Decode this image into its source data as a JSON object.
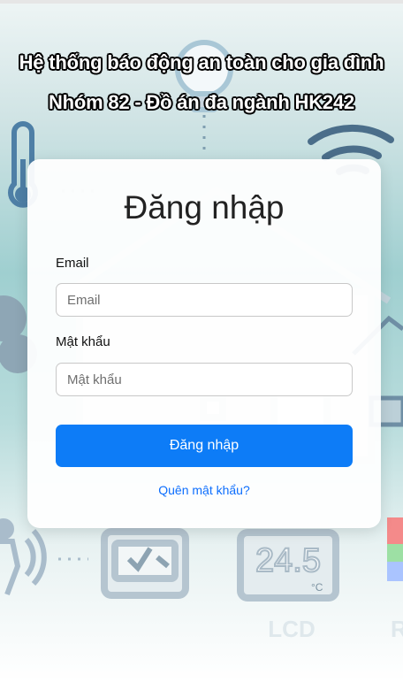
{
  "header": {
    "title": "Hệ thống báo động an toàn cho gia đình",
    "subtitle": "Nhóm 82 - Đồ án đa ngành HK242"
  },
  "login": {
    "heading": "Đăng nhập",
    "email_label": "Email",
    "email_placeholder": "Email",
    "email_value": "",
    "password_label": "Mật khẩu",
    "password_placeholder": "Mật khẩu",
    "password_value": "",
    "submit_label": "Đăng nhập",
    "forgot_link": "Quên mật khẩu?"
  },
  "background": {
    "lcd_reading": "24.5",
    "lcd_unit": "°C",
    "lcd_label": "LCD",
    "r_label": "R",
    "icons": [
      "lightbulb-icon",
      "thermometer-icon",
      "wifi-icon",
      "house-icon",
      "cloud-icon",
      "motion-sensor-icon",
      "microcontroller-icon",
      "lcd-display-icon",
      "rgb-led-icon"
    ]
  },
  "colors": {
    "primary_button": "#0d7cf7",
    "link": "#0d6efd",
    "background_teal": "#9fcfd0"
  }
}
